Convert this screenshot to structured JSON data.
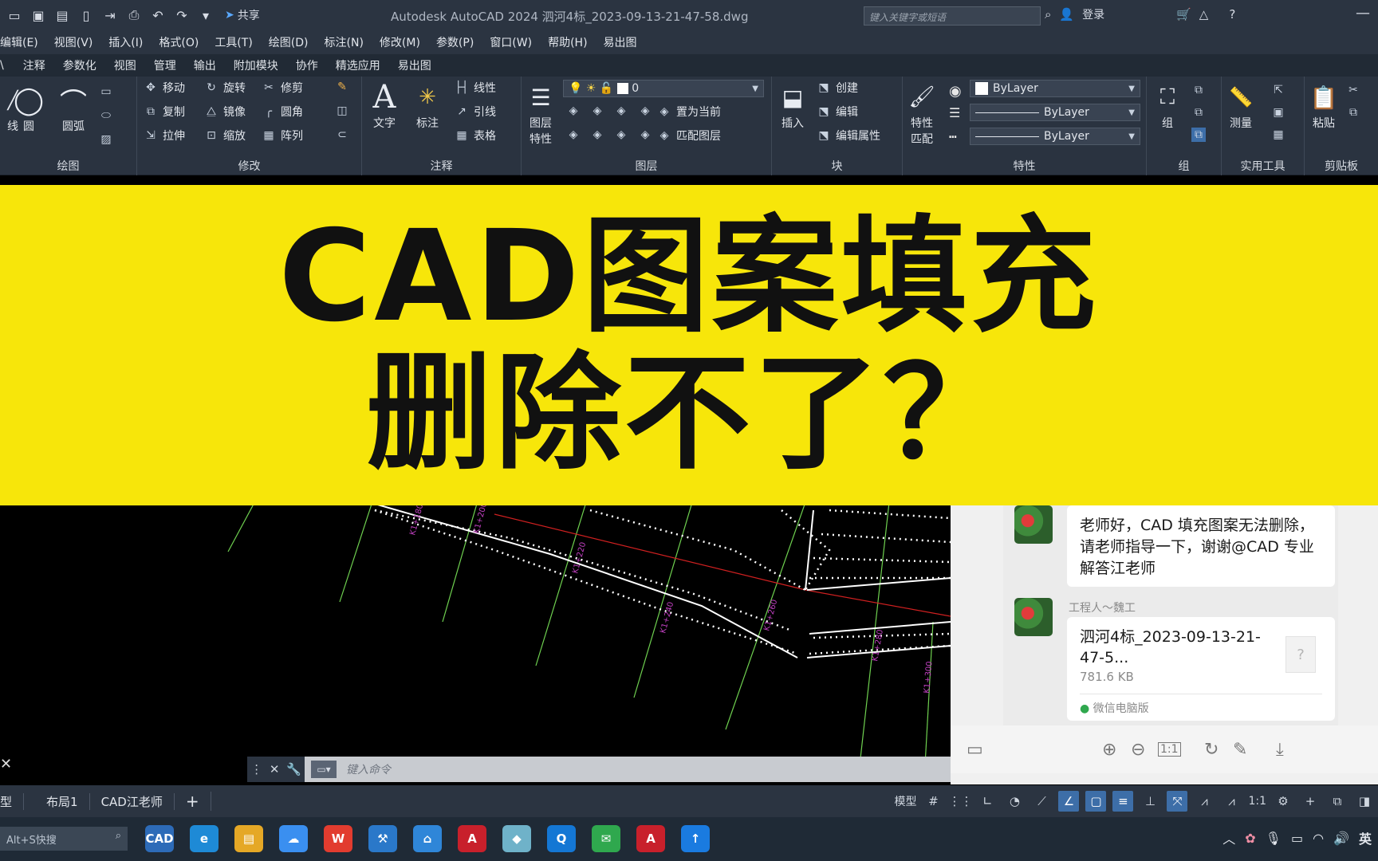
{
  "titlebar": {
    "title": "Autodesk AutoCAD 2024    泗河4标_2023-09-13-21-47-58.dwg",
    "share": "共享",
    "search_placeholder": "键入关键字或短语",
    "login": "登录"
  },
  "menubar": [
    "编辑(E)",
    "视图(V)",
    "插入(I)",
    "格式(O)",
    "工具(T)",
    "绘图(D)",
    "标注(N)",
    "修改(M)",
    "参数(P)",
    "窗口(W)",
    "帮助(H)",
    "易出图"
  ],
  "ribbon_tabs": [
    "注释",
    "参数化",
    "视图",
    "管理",
    "输出",
    "附加模块",
    "协作",
    "精选应用",
    "易出图"
  ],
  "ribbon": {
    "draw": {
      "title": "绘图",
      "buttons": [
        "线",
        "圆",
        "圆弧"
      ]
    },
    "modify": {
      "title": "修改",
      "rows": [
        [
          "移动",
          "旋转",
          "修剪"
        ],
        [
          "复制",
          "镜像",
          "圆角"
        ],
        [
          "拉伸",
          "缩放",
          "阵列"
        ]
      ]
    },
    "annotation": {
      "title": "注释",
      "text": "文字",
      "dim": "标注",
      "items": [
        "线性",
        "引线",
        "表格"
      ]
    },
    "layers": {
      "title": "图层",
      "props": "图层\n特性",
      "current_layer": "0",
      "set_current": "置为当前",
      "match": "匹配图层"
    },
    "block": {
      "title": "块",
      "insert": "插入",
      "items": [
        "创建",
        "编辑",
        "编辑属性"
      ]
    },
    "properties": {
      "title": "特性",
      "match": "特性\n匹配",
      "values": [
        "ByLayer",
        "ByLayer",
        "ByLayer"
      ]
    },
    "group": {
      "title": "组",
      "label": "组"
    },
    "utilities": {
      "title": "实用工具",
      "label": "测量"
    },
    "clipboard": {
      "title": "剪贴板",
      "label": "粘贴"
    }
  },
  "banner": {
    "line1": "CAD图案填充",
    "line2": "删除不了？"
  },
  "chat": {
    "msg1": "老师好，CAD 填充图案无法删除，请老师指导一下，谢谢@CAD 专业解答江老师",
    "sender2": "工程人～魏工",
    "file_name": "泗河4标_2023-09-13-21-47-5...",
    "file_size": "781.6 KB",
    "source": "微信电脑版"
  },
  "cmdline": {
    "placeholder": "键入命令"
  },
  "layout_tabs": [
    "型",
    "布局1",
    "CAD江老师"
  ],
  "status": {
    "model": "模型",
    "scale": "1:1"
  },
  "taskbar": {
    "search": "Alt+S快搜",
    "apps": [
      {
        "name": "cad-viewer",
        "label": "CAD",
        "color": "#2d6bb8"
      },
      {
        "name": "edge",
        "label": "e",
        "color": "#1e8ad6"
      },
      {
        "name": "explorer",
        "label": "▤",
        "color": "#e5a826"
      },
      {
        "name": "baidu-netdisk",
        "label": "☁",
        "color": "#3a8ff0"
      },
      {
        "name": "wps",
        "label": "W",
        "color": "#e23c2f"
      },
      {
        "name": "tools",
        "label": "⚒",
        "color": "#2a78c9"
      },
      {
        "name": "cad-assist",
        "label": "⌂",
        "color": "#2f86d8"
      },
      {
        "name": "autocad",
        "label": "A",
        "color": "#c8202b"
      },
      {
        "name": "notes",
        "label": "◆",
        "color": "#6fb2c9"
      },
      {
        "name": "qq-browser",
        "label": "Q",
        "color": "#1477d4"
      },
      {
        "name": "wechat",
        "label": "✉",
        "color": "#2fa84e"
      },
      {
        "name": "autocad-2",
        "label": "A",
        "color": "#c8202b"
      },
      {
        "name": "helper",
        "label": "↑",
        "color": "#1a7be0"
      }
    ],
    "ime": "英"
  }
}
